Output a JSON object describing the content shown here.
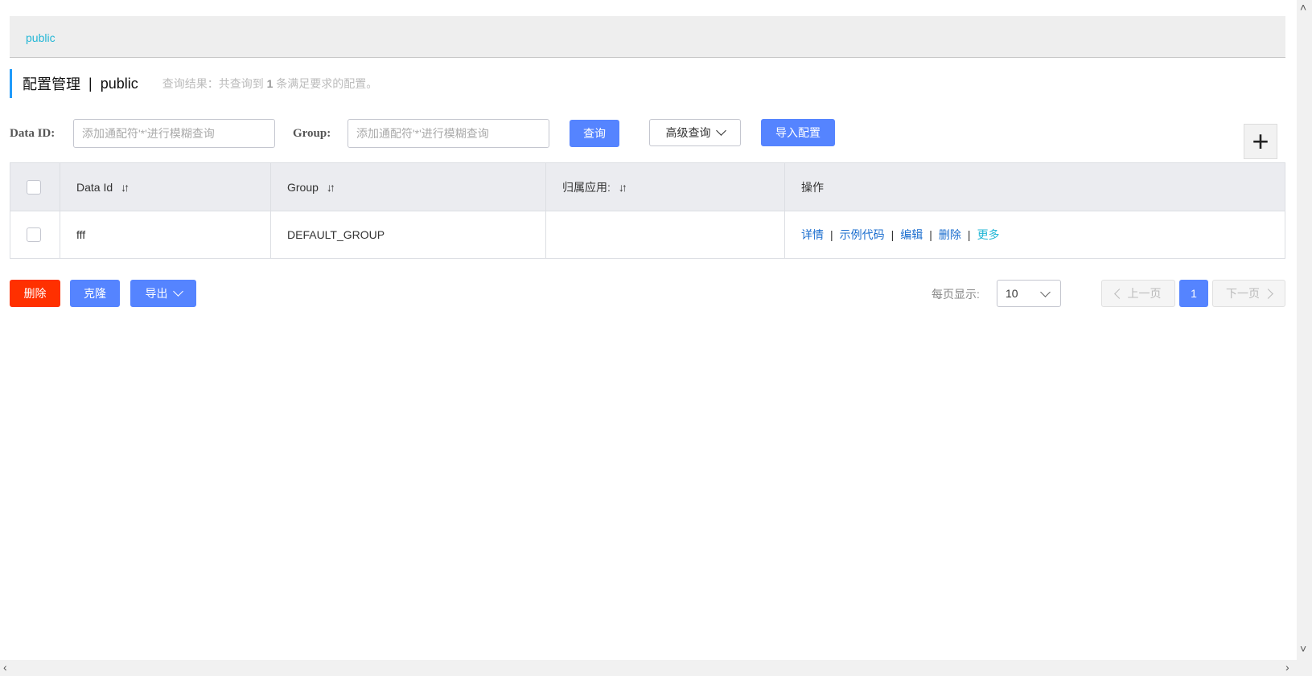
{
  "namespace": {
    "tab_label": "public"
  },
  "title": {
    "main": "配置管理",
    "separator": "|",
    "namespace": "public",
    "result_prefix": "查询结果：共查询到",
    "result_count": "1",
    "result_suffix": "条满足要求的配置。"
  },
  "filters": {
    "data_id_label": "Data ID:",
    "data_id_placeholder": "添加通配符'*'进行模糊查询",
    "group_label": "Group:",
    "group_placeholder": "添加通配符'*'进行模糊查询",
    "query_button": "查询",
    "advanced_button": "高级查询",
    "import_button": "导入配置",
    "add_button": "+"
  },
  "table": {
    "columns": [
      "Data Id",
      "Group",
      "归属应用:",
      "操作"
    ],
    "sort_icon": "sort-icon",
    "rows": [
      {
        "data_id": "fff",
        "group": "DEFAULT_GROUP",
        "app": "",
        "actions": {
          "detail": "详情",
          "sample_code": "示例代码",
          "edit": "编辑",
          "delete": "删除",
          "more": "更多"
        }
      }
    ]
  },
  "batch": {
    "delete_button": "删除",
    "clone_button": "克隆",
    "export_button": "导出"
  },
  "pagination": {
    "page_size_label": "每页显示:",
    "page_size_value": "10",
    "prev_label": "上一页",
    "current_page": "1",
    "next_label": "下一页"
  },
  "colors": {
    "primary": "#5584ff",
    "danger": "#ff3000",
    "link": "#1a6dce",
    "accent": "#23b7d6"
  }
}
